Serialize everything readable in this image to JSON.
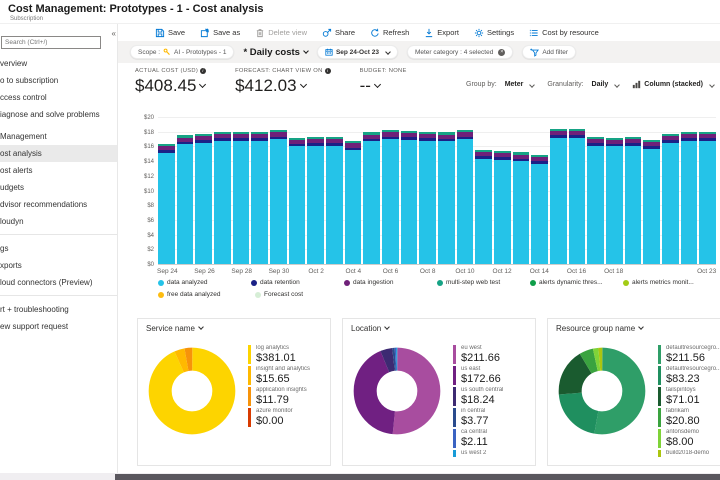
{
  "header": {
    "title": "Cost Management: Prototypes - 1 - Cost analysis",
    "subtitle": "Subscription"
  },
  "sidebar": {
    "search_placeholder": "Search (Ctrl+/)",
    "collapse_glyph": "«",
    "items": [
      {
        "type": "item",
        "label": "verview"
      },
      {
        "type": "item",
        "label": "o to subscription"
      },
      {
        "type": "item",
        "label": "ccess control"
      },
      {
        "type": "item",
        "label": "iagnose and solve problems"
      },
      {
        "type": "header",
        "label": "Management"
      },
      {
        "type": "item",
        "label": "ost analysis",
        "selected": true
      },
      {
        "type": "item",
        "label": "ost alerts"
      },
      {
        "type": "item",
        "label": "udgets"
      },
      {
        "type": "item",
        "label": "dvisor recommendations"
      },
      {
        "type": "item",
        "label": "loudyn"
      },
      {
        "type": "divider"
      },
      {
        "type": "header",
        "label": "gs"
      },
      {
        "type": "item",
        "label": "xports"
      },
      {
        "type": "item",
        "label": "loud connectors (Preview)"
      },
      {
        "type": "divider"
      },
      {
        "type": "header",
        "label": "rt + troubleshooting"
      },
      {
        "type": "item",
        "label": "ew support request"
      }
    ]
  },
  "toolbar": {
    "items": [
      {
        "label": "Save"
      },
      {
        "label": "Save as"
      },
      {
        "label": "Delete view",
        "disabled": true
      },
      {
        "label": "Share"
      },
      {
        "label": "Refresh"
      },
      {
        "label": "Export"
      },
      {
        "label": "Settings"
      },
      {
        "label": "Cost by resource"
      }
    ]
  },
  "filters": {
    "scope_label": "Scope :",
    "scope_value": "AI - Prototypes - 1",
    "view_name": "* Daily costs",
    "date_range": "Sep 24-Oct 23",
    "meter_pill": "Meter category : 4 selected",
    "remove_glyph": "×",
    "add_filter": "Add filter"
  },
  "kpis": [
    {
      "label": "ACTUAL COST (USD)",
      "value": "$408.45",
      "info": "i"
    },
    {
      "label": "FORECAST: CHART VIEW ON",
      "value": "$412.03",
      "info": "i"
    },
    {
      "label": "BUDGET: NONE",
      "value": "--"
    }
  ],
  "controls": {
    "group_by_label": "Group by:",
    "group_by_value": "Meter",
    "granularity_label": "Granularity:",
    "granularity_value": "Daily",
    "chart_type": "Column (stacked)"
  },
  "chart_data": [
    {
      "type": "bar",
      "stacked": true,
      "ylim": [
        0,
        20
      ],
      "ytick_step": 2,
      "ytick_prefix": "$",
      "grid": true,
      "categories": [
        "Sep 24",
        "Sep 25",
        "Sep 26",
        "Sep 27",
        "Sep 28",
        "Sep 29",
        "Sep 30",
        "Oct 1",
        "Oct 2",
        "Oct 3",
        "Oct 4",
        "Oct 5",
        "Oct 6",
        "Oct 7",
        "Oct 8",
        "Oct 9",
        "Oct 10",
        "Oct 11",
        "Oct 12",
        "Oct 13",
        "Oct 14",
        "Oct 15",
        "Oct 16",
        "Oct 17",
        "Oct 18",
        "Oct 19",
        "Oct 20",
        "Oct 21",
        "Oct 22",
        "Oct 23"
      ],
      "x_tick_labels": [
        {
          "i": 0,
          "label": "Sep 24"
        },
        {
          "i": 2,
          "label": "Sep 26"
        },
        {
          "i": 4,
          "label": "Sep 28"
        },
        {
          "i": 6,
          "label": "Sep 30"
        },
        {
          "i": 8,
          "label": "Oct 2"
        },
        {
          "i": 10,
          "label": "Oct 4"
        },
        {
          "i": 12,
          "label": "Oct 6"
        },
        {
          "i": 14,
          "label": "Oct 8"
        },
        {
          "i": 16,
          "label": "Oct 10"
        },
        {
          "i": 18,
          "label": "Oct 12"
        },
        {
          "i": 20,
          "label": "Oct 14"
        },
        {
          "i": 22,
          "label": "Oct 16"
        },
        {
          "i": 24,
          "label": "Oct 18"
        },
        {
          "i": 29,
          "label": "Oct 23"
        }
      ],
      "series": [
        {
          "name": "data analyzed",
          "color": "#25c3e8",
          "values": [
            15.1,
            16.3,
            16.5,
            16.8,
            16.8,
            16.8,
            17.0,
            16.0,
            16.1,
            16.1,
            15.5,
            16.7,
            17.0,
            16.9,
            16.8,
            16.7,
            17.0,
            14.3,
            14.2,
            14.0,
            13.6,
            17.2,
            17.2,
            16.1,
            16.0,
            16.1,
            15.7,
            16.5,
            16.8,
            16.8
          ]
        },
        {
          "name": "data retention",
          "color": "#1b2186",
          "uniform_value": 0.35
        },
        {
          "name": "data ingestion",
          "color": "#6f2079",
          "uniform_value": 0.55
        },
        {
          "name": "multi-step web test",
          "color": "#16a385",
          "uniform_value": 0.3
        }
      ],
      "legend": {
        "row1": [
          {
            "name": "data analyzed",
            "color": "#25c3e8"
          },
          {
            "name": "data retention",
            "color": "#1b2186"
          },
          {
            "name": "data ingestion",
            "color": "#6f2079"
          },
          {
            "name": "multi-step web test",
            "color": "#16a385"
          },
          {
            "name": "alerts dynamic thres...",
            "color": "#0f9e49"
          },
          {
            "name": "alerts metrics monit...",
            "color": "#a3cc16"
          }
        ],
        "row2": [
          {
            "name": "free data analyzed",
            "color": "#fdbc11"
          },
          {
            "name": "Forecast cost",
            "color": "#d6eed6"
          }
        ]
      }
    },
    {
      "type": "donut",
      "title": "Service name",
      "slices": [
        {
          "name": "log analytics",
          "display": "$381.01",
          "value": 381.01,
          "color": "#fdd400"
        },
        {
          "name": "insight and analytics",
          "display": "$15.65",
          "value": 15.65,
          "color": "#ffb900"
        },
        {
          "name": "application insights",
          "display": "$11.79",
          "value": 11.79,
          "color": "#f7930a"
        },
        {
          "name": "azure monitor",
          "display": "$0.00",
          "value": 0.01,
          "color": "#d83b01"
        }
      ]
    },
    {
      "type": "donut",
      "title": "Location",
      "slices": [
        {
          "name": "eu west",
          "display": "$211.66",
          "value": 211.66,
          "color": "#a84d9f"
        },
        {
          "name": "us east",
          "display": "$172.66",
          "value": 172.66,
          "color": "#702082"
        },
        {
          "name": "us south central",
          "display": "$18.24",
          "value": 18.24,
          "color": "#3d2a72"
        },
        {
          "name": "in central",
          "display": "$3.77",
          "value": 3.77,
          "color": "#2a4b8d"
        },
        {
          "name": "ca central",
          "display": "$2.11",
          "value": 2.11,
          "color": "#3b63c2"
        },
        {
          "name": "us west 2",
          "display": "",
          "value": 2.0,
          "color": "#189bd7"
        }
      ]
    },
    {
      "type": "donut",
      "title": "Resource group name",
      "slices": [
        {
          "name": "defaultresourcegro...",
          "display": "$211.56",
          "value": 211.56,
          "color": "#2f9e68"
        },
        {
          "name": "defaultresourcegro...",
          "display": "$83.23",
          "value": 83.23,
          "color": "#1f8f5f"
        },
        {
          "name": "tailspintoys",
          "display": "$71.01",
          "value": 71.01,
          "color": "#1a5b2f"
        },
        {
          "name": "fabrikam",
          "display": "$20.80",
          "value": 20.8,
          "color": "#3aa33f"
        },
        {
          "name": "antonsdemo",
          "display": "$8.00",
          "value": 8.0,
          "color": "#7fd338"
        },
        {
          "name": "build2018-demo",
          "display": "",
          "value": 6.0,
          "color": "#abc50f"
        }
      ]
    }
  ]
}
